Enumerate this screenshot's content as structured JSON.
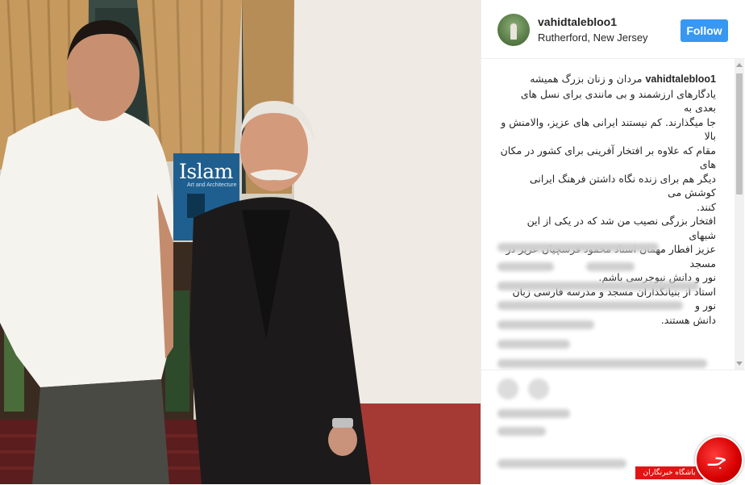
{
  "post": {
    "username": "vahidtalebloo1",
    "location": "Rutherford, New Jersey",
    "follow_label": "Follow",
    "caption_username": "vahidtalebloo1",
    "caption_lines": [
      "مردان و زنان بزرگ همیشه",
      "یادگارهای ارزشمند و بی مانندی برای نسل های بعدی به",
      "جا میگذارند. کم نیستند ایرانی های عزیز، والامنش و بالا",
      "مقام که علاوه بر افتخار آفرینی برای کشور در مکان های",
      "دیگر هم برای زنده نگاه داشتن فرهنگ ایرانی کوشش می",
      "کنند.",
      "افتخار بزرگی نصیب من شد که در یکی از این شبهای",
      "عزیز افطار مهمان استاد محمود فرشچیان عزیز در مسجد",
      "نور و دانش نیوجرسی باشم.",
      "استاد از بنیانگذاران مسجد و مدرسه فارسی زبان نور و",
      "دانش هستند."
    ]
  },
  "photo": {
    "book_title": "Islam",
    "book_subtitle": "Art and Architecture"
  },
  "watermark": {
    "label": "باشگاه خبرنگاران",
    "glyph": "جـ"
  },
  "colors": {
    "follow_button": "#3897f0",
    "watermark": "#e21414"
  }
}
